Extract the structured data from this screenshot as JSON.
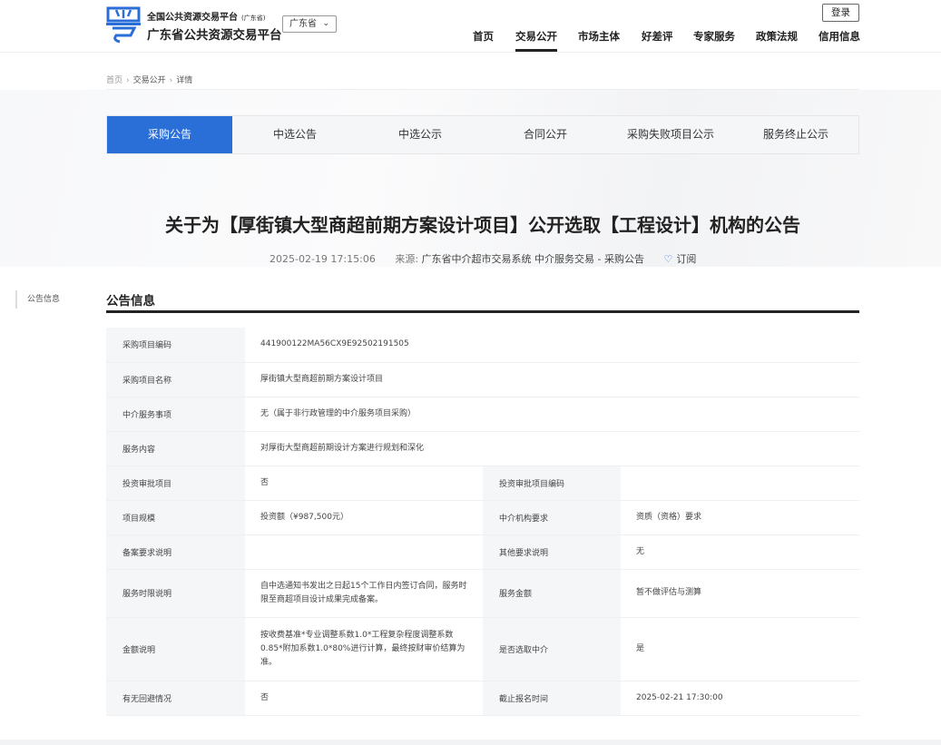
{
  "header": {
    "logo_top": "全国公共资源交易平台",
    "logo_top_small": "(广东省)",
    "logo_main": "广东省公共资源交易平台",
    "province_select": "广东省",
    "login_label": "登录",
    "nav": [
      "首页",
      "交易公开",
      "市场主体",
      "好差评",
      "专家服务",
      "政策法规",
      "信用信息"
    ],
    "active_nav": "交易公开"
  },
  "breadcrumb": [
    "首页",
    "交易公开",
    "详情"
  ],
  "tabs": [
    "采购公告",
    "中选公告",
    "中选公示",
    "合同公开",
    "采购失败项目公示",
    "服务终止公示"
  ],
  "active_tab": "采购公告",
  "notice": {
    "title": "关于为【厚街镇大型商超前期方案设计项目】公开选取【工程设计】机构的公告",
    "date": "2025-02-19 17:15:06",
    "source_label": "来源:",
    "source_value": "广东省中介超市交易系统 中介服务交易 - 采购公告",
    "subscribe_label": "订阅"
  },
  "side_nav": {
    "item": "公告信息"
  },
  "section_title": "公告信息",
  "rows_full": [
    {
      "label": "采购项目编码",
      "value": "441900122MA56CX9E92502191505"
    },
    {
      "label": "采购项目名称",
      "value": "厚街镇大型商超前期方案设计项目"
    },
    {
      "label": "中介服务事项",
      "value": "无（属于非行政管理的中介服务项目采购）"
    },
    {
      "label": "服务内容",
      "value": "对厚街大型商超前期设计方案进行规划和深化"
    }
  ],
  "rows_half": [
    {
      "label1": "投资审批项目",
      "value1": "否",
      "label2": "投资审批项目编码",
      "value2": ""
    },
    {
      "label1": "项目规模",
      "value1": "投资额（¥987,500元）",
      "label2": "中介机构要求",
      "value2": "资质（资格）要求"
    },
    {
      "label1": "备案要求说明",
      "value1": "",
      "label2": "其他要求说明",
      "value2": "无"
    },
    {
      "label1": "服务时限说明",
      "value1": "自中选通知书发出之日起15个工作日内签订合同，服务时限至商超项目设计成果完成备案。",
      "label2": "服务金额",
      "value2": "暂不做评估与测算"
    },
    {
      "label1": "金额说明",
      "value1": "按收费基准*专业调整系数1.0*工程复杂程度调整系数0.85*附加系数1.0*80%进行计算，最终按财审价结算为准。",
      "label2": "是否选取中介",
      "value2": "是"
    },
    {
      "label1": "有无回避情况",
      "value1": "否",
      "label2": "截止报名时间",
      "value2": "2025-02-21 17:30:00"
    }
  ]
}
